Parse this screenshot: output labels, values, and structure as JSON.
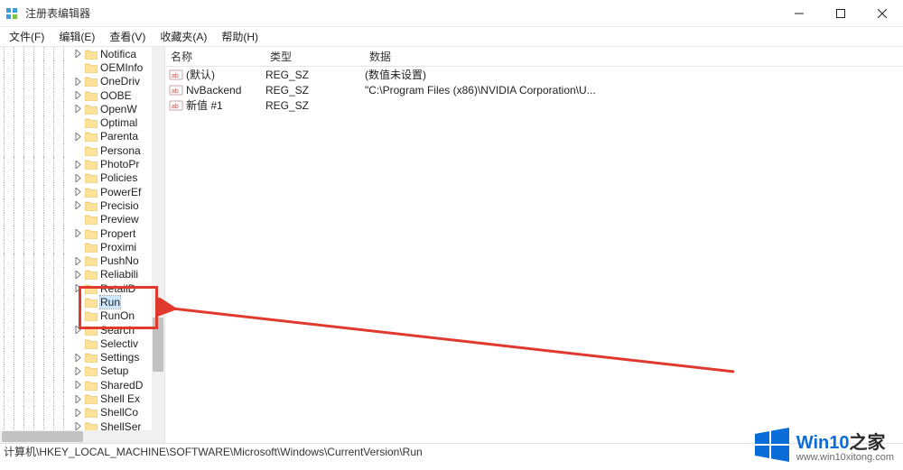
{
  "window": {
    "title": "注册表编辑器"
  },
  "menu": {
    "file": "文件(F)",
    "edit": "编辑(E)",
    "view": "查看(V)",
    "favorites": "收藏夹(A)",
    "help": "帮助(H)"
  },
  "tree": {
    "items": [
      {
        "label": "Notifica",
        "expander": "right",
        "indent": 7
      },
      {
        "label": "OEMInfo",
        "expander": "none",
        "indent": 7
      },
      {
        "label": "OneDriv",
        "expander": "right",
        "indent": 7
      },
      {
        "label": "OOBE",
        "expander": "right",
        "indent": 7
      },
      {
        "label": "OpenW",
        "expander": "right",
        "indent": 7
      },
      {
        "label": "Optimal",
        "expander": "none",
        "indent": 7
      },
      {
        "label": "Parenta",
        "expander": "right",
        "indent": 7
      },
      {
        "label": "Persona",
        "expander": "none",
        "indent": 7
      },
      {
        "label": "PhotoPr",
        "expander": "right",
        "indent": 7
      },
      {
        "label": "Policies",
        "expander": "right",
        "indent": 7
      },
      {
        "label": "PowerEf",
        "expander": "right",
        "indent": 7
      },
      {
        "label": "Precisio",
        "expander": "right",
        "indent": 7
      },
      {
        "label": "Preview",
        "expander": "none",
        "indent": 7
      },
      {
        "label": "Propert",
        "expander": "right",
        "indent": 7
      },
      {
        "label": "Proximi",
        "expander": "none",
        "indent": 7
      },
      {
        "label": "PushNo",
        "expander": "right",
        "indent": 7
      },
      {
        "label": "Reliabili",
        "expander": "right",
        "indent": 7
      },
      {
        "label": "RetailD",
        "expander": "right",
        "indent": 7
      },
      {
        "label": "Run",
        "expander": "none",
        "indent": 7,
        "selected": true
      },
      {
        "label": "RunOn",
        "expander": "none",
        "indent": 7
      },
      {
        "label": "Search",
        "expander": "right",
        "indent": 7
      },
      {
        "label": "Selectiv",
        "expander": "none",
        "indent": 7
      },
      {
        "label": "Settings",
        "expander": "right",
        "indent": 7
      },
      {
        "label": "Setup",
        "expander": "right",
        "indent": 7
      },
      {
        "label": "SharedD",
        "expander": "right",
        "indent": 7
      },
      {
        "label": "Shell Ex",
        "expander": "right",
        "indent": 7
      },
      {
        "label": "ShellCo",
        "expander": "right",
        "indent": 7
      },
      {
        "label": "ShellSer",
        "expander": "right",
        "indent": 7
      }
    ]
  },
  "list": {
    "columns": {
      "name": "名称",
      "type": "类型",
      "data": "数据"
    },
    "rows": [
      {
        "name": "(默认)",
        "type": "REG_SZ",
        "data": "(数值未设置)"
      },
      {
        "name": "NvBackend",
        "type": "REG_SZ",
        "data": "\"C:\\Program Files (x86)\\NVIDIA Corporation\\U..."
      },
      {
        "name": "新值 #1",
        "type": "REG_SZ",
        "data": ""
      }
    ]
  },
  "status": {
    "path": "计算机\\HKEY_LOCAL_MACHINE\\SOFTWARE\\Microsoft\\Windows\\CurrentVersion\\Run"
  },
  "watermark": {
    "brand_prefix": "Win10",
    "brand_suffix": "之家",
    "url": "www.win10xitong.com"
  }
}
